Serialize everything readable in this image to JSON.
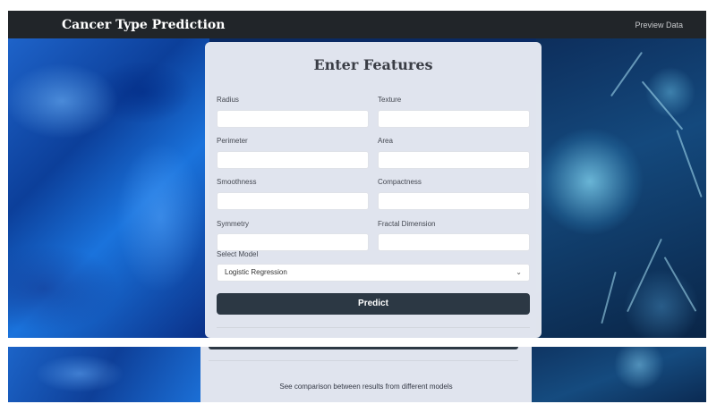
{
  "navbar": {
    "brand": "Cancer Type Prediction",
    "preview_link": "Preview Data"
  },
  "form": {
    "title": "Enter Features",
    "fields": [
      {
        "label": "Radius",
        "value": ""
      },
      {
        "label": "Texture",
        "value": ""
      },
      {
        "label": "Perimeter",
        "value": ""
      },
      {
        "label": "Area",
        "value": ""
      },
      {
        "label": "Smoothness",
        "value": ""
      },
      {
        "label": "Compactness",
        "value": ""
      },
      {
        "label": "Symmetry",
        "value": ""
      },
      {
        "label": "Fractal Dimension",
        "value": ""
      }
    ],
    "model_label": "Select Model",
    "model_selected": "Logistic Regression",
    "predict_label": "Predict"
  },
  "footer": {
    "comparison_link": "See comparison between results from different models"
  },
  "colors": {
    "navbar": "#212529",
    "button": "#2c3844",
    "card": "#eceef6"
  }
}
